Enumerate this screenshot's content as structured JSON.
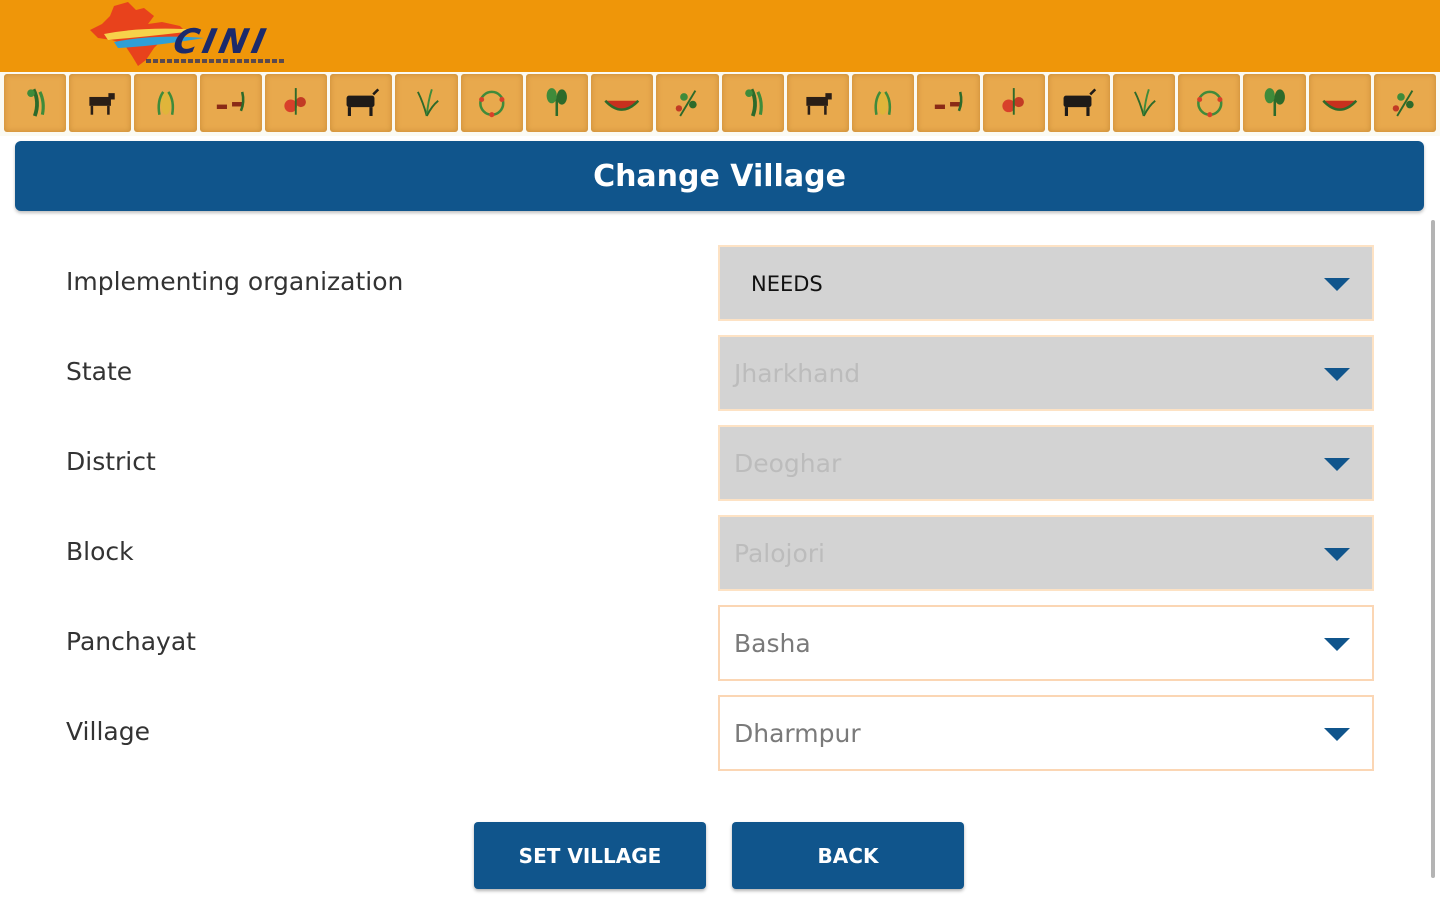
{
  "app": {
    "logo_text": "CINI",
    "brand_color": "#ef9609",
    "accent_color": "#10558c"
  },
  "header": {
    "title": "Change Village"
  },
  "decor_strip": {
    "icons": [
      "gourd-icon",
      "cow-icon",
      "corn-icon",
      "goats-icon",
      "tomato-plant-icon",
      "buffalo-icon",
      "grass-icon",
      "flower-wreath-icon",
      "spinach-icon",
      "watermelon-icon",
      "herb-icon",
      "gourd-icon",
      "cow-icon",
      "corn-icon",
      "goats-icon",
      "tomato-plant-icon",
      "buffalo-icon",
      "grass-icon",
      "flower-wreath-icon",
      "spinach-icon",
      "watermelon-icon",
      "herb-icon"
    ]
  },
  "form": {
    "fields": [
      {
        "label": "Implementing organization",
        "value": "NEEDS",
        "enabled": true
      },
      {
        "label": "State",
        "value": "Jharkhand",
        "enabled": false
      },
      {
        "label": "District",
        "value": "Deoghar",
        "enabled": false
      },
      {
        "label": "Block",
        "value": "Palojori",
        "enabled": false
      },
      {
        "label": "Panchayat",
        "value": "Basha",
        "enabled": true
      },
      {
        "label": "Village",
        "value": "Dharmpur",
        "enabled": true
      }
    ]
  },
  "actions": {
    "set_village": "SET VILLAGE",
    "back": "BACK"
  }
}
